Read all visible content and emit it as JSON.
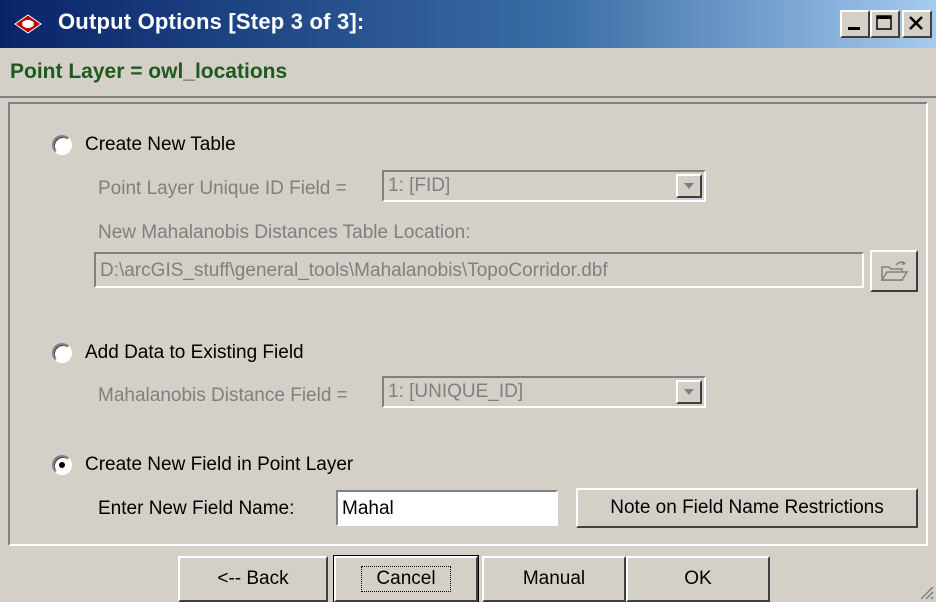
{
  "window": {
    "title": "Output Options [Step 3 of 3]:",
    "controls": {
      "minimize": "minimize-icon",
      "maximize": "maximize-icon",
      "close": "close-icon"
    }
  },
  "header": {
    "layer_label": "Point Layer = owl_locations"
  },
  "options": {
    "create_table": {
      "label": "Create New Table",
      "selected": false,
      "uid_label": "Point Layer Unique ID Field =",
      "uid_value": "1:  [FID]",
      "location_label": "New Mahalanobis Distances Table Location:",
      "location_value": "D:\\arcGIS_stuff\\general_tools\\Mahalanobis\\TopoCorridor.dbf",
      "browse_icon": "open-folder-icon"
    },
    "existing_field": {
      "label": "Add Data to Existing Field",
      "selected": false,
      "field_label": "Mahalanobis Distance Field =",
      "field_value": "1:  [UNIQUE_ID]"
    },
    "new_field": {
      "label": "Create New Field in Point Layer",
      "selected": true,
      "name_label": "Enter New Field Name:",
      "name_value": "Mahal",
      "note_button": "Note on Field Name Restrictions"
    }
  },
  "footer": {
    "back": "<-- Back",
    "cancel": "Cancel",
    "manual": "Manual",
    "ok": "OK"
  }
}
